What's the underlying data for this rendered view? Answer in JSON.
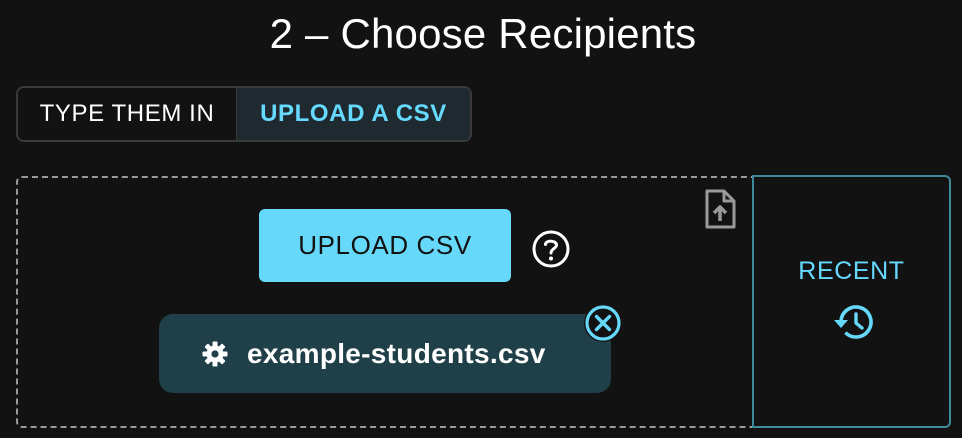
{
  "page": {
    "title": "2 – Choose Recipients"
  },
  "tabs": [
    {
      "label": "TYPE THEM IN",
      "selected": false
    },
    {
      "label": "UPLOAD A CSV",
      "selected": true
    }
  ],
  "upload": {
    "button_label": "UPLOAD CSV",
    "file_icon": "file-upload-icon",
    "help_icon": "help-circle-icon"
  },
  "file": {
    "name": "example-students.csv",
    "icon": "gear-icon",
    "remove_icon": "close-circle-icon"
  },
  "recent": {
    "label": "RECENT",
    "icon": "history-icon"
  },
  "colors": {
    "background": "#121212",
    "accent": "#66d9fa",
    "chip": "#1f4048",
    "selected_tab_bg": "#1f2a30",
    "recent_border": "#3d8a9a"
  }
}
